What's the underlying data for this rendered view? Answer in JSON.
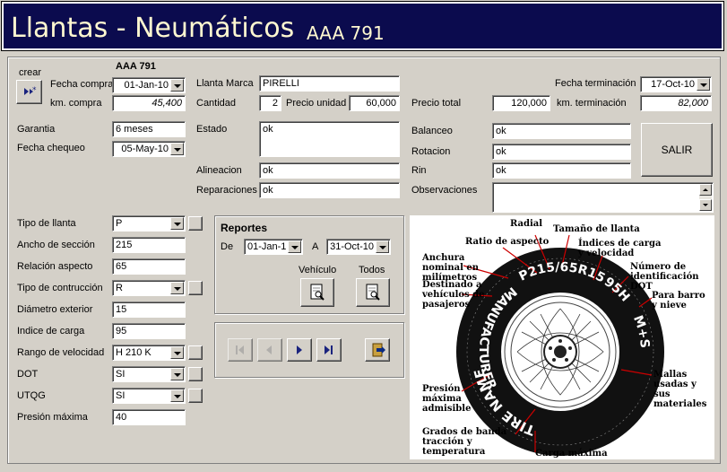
{
  "title": {
    "main": "Llantas - Neumáticos",
    "plate": "AAA 791"
  },
  "form": {
    "plate": "AAA 791",
    "crear_label": "crear",
    "fecha_compra_label": "Fecha compra",
    "fecha_compra": "01-Jan-10",
    "km_compra_label": "km. compra",
    "km_compra": "45,400",
    "llanta_marca_label": "Llanta Marca",
    "llanta_marca": "PIRELLI",
    "cantidad_label": "Cantidad",
    "cantidad": "2",
    "precio_unidad_label": "Precio unidad",
    "precio_unidad": "60,000",
    "precio_total_label": "Precio total",
    "precio_total": "120,000",
    "fecha_terminacion_label": "Fecha terminación",
    "fecha_terminacion": "17-Oct-10",
    "km_terminacion_label": "km. terminación",
    "km_terminacion": "82,000",
    "garantia_label": "Garantia",
    "garantia": "6 meses",
    "fecha_chequeo_label": "Fecha chequeo",
    "fecha_chequeo": "05-May-10",
    "estado_label": "Estado",
    "estado": "ok",
    "alineacion_label": "Alineacion",
    "alineacion": "ok",
    "reparaciones_label": "Reparaciones",
    "reparaciones": "ok",
    "balanceo_label": "Balanceo",
    "balanceo": "ok",
    "rotacion_label": "Rotacion",
    "rotacion": "ok",
    "rin_label": "Rin",
    "rin": "ok",
    "observaciones_label": "Observaciones",
    "observaciones": "",
    "salir_label": "SALIR"
  },
  "specs": [
    {
      "label": "Tipo de llanta",
      "value": "P",
      "kind": "select",
      "extra": true
    },
    {
      "label": "Ancho de sección",
      "value": "215",
      "kind": "input"
    },
    {
      "label": "Relación aspecto",
      "value": "65",
      "kind": "input"
    },
    {
      "label": "Tipo de contrucción",
      "value": "R",
      "kind": "select",
      "extra": true
    },
    {
      "label": "Diámetro exterior",
      "value": "15",
      "kind": "input"
    },
    {
      "label": "Indice de carga",
      "value": "95",
      "kind": "input"
    },
    {
      "label": "Rango de velocidad",
      "value": "H 210 K",
      "kind": "select",
      "extra": true
    },
    {
      "label": "DOT",
      "value": "SI",
      "kind": "select",
      "extra": true
    },
    {
      "label": "UTQG",
      "value": "SI",
      "kind": "select",
      "extra": true
    },
    {
      "label": "Presión máxima",
      "value": "40",
      "kind": "input"
    }
  ],
  "reportes": {
    "title": "Reportes",
    "de_label": "De",
    "de": "01-Jan-10",
    "a_label": "A",
    "a": "31-Oct-10",
    "vehiculo_label": "Vehículo",
    "todos_label": "Todos"
  },
  "tire_diagram": {
    "sidewall_size": "P215/65R15",
    "sidewall_load": "95H",
    "sidewall_ms": "M+S",
    "sidewall_name": "TIRE NAME",
    "sidewall_maker": "MANUFACTURER",
    "labels": {
      "radial": "Radial",
      "tamano": "Tamaño de llanta",
      "ratio": "Ratio de aspecto",
      "indices": "Índices de carga y velocidad",
      "anchura": "Anchura nominal en milímetros",
      "numero_dot": "Número de identificación DOT",
      "destinado": "Destinado a vehículos de pasajeros",
      "barro": "Para barro y nieve",
      "mallas": "Mallas usadas y sus materiales",
      "presion": "Presión máxima admisible",
      "grados": "Grados de banda tracción y temperatura",
      "carga": "Carga máxima"
    }
  },
  "colors": {
    "title_bg": "#0b0b4e",
    "title_fg": "#fff8d0",
    "window_bg": "#d4d0c8",
    "nav_arrow": "#1a237e",
    "callout_line": "#cc0000"
  }
}
